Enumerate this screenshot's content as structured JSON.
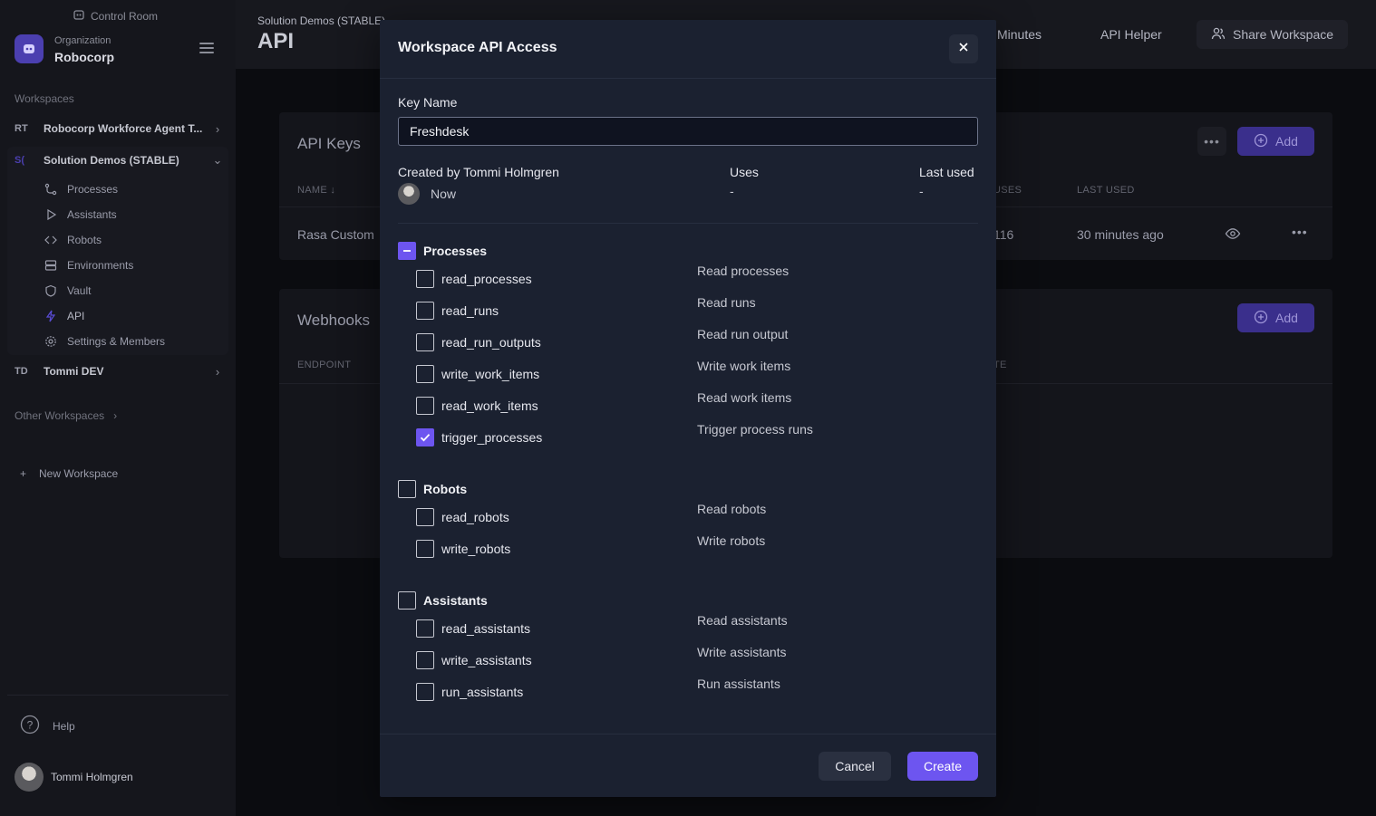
{
  "sidebar": {
    "control_room": "Control Room",
    "org_label": "Organization",
    "org_name": "Robocorp",
    "workspaces_title": "Workspaces",
    "workspaces": [
      {
        "abbr": "RT",
        "name": "Robocorp Workforce Agent T..."
      },
      {
        "abbr": "S(",
        "name": "Solution Demos (STABLE)"
      },
      {
        "abbr": "TD",
        "name": "Tommi DEV"
      }
    ],
    "nav": [
      "Processes",
      "Assistants",
      "Robots",
      "Environments",
      "Vault",
      "API",
      "Settings & Members"
    ],
    "other_workspaces": "Other Workspaces",
    "new_workspace": "New Workspace",
    "help": "Help",
    "user_name": "Tommi Holmgren"
  },
  "topbar": {
    "crumb": "Solution Demos (STABLE)",
    "title": "API",
    "minutes": "Minutes",
    "api_helper": "API Helper",
    "share": "Share Workspace"
  },
  "page": {
    "api_keys_title": "API Keys",
    "col_name": "NAME",
    "col_uses": "USES",
    "col_last_used": "LAST USED",
    "row_name": "Rasa Custom",
    "row_uses": "116",
    "row_last_used": "30 minutes ago",
    "add_label": "Add",
    "webhooks_title": "Webhooks",
    "col_endpoint": "ENDPOINT",
    "col_te": "TE"
  },
  "modal": {
    "title": "Workspace API Access",
    "key_name_label": "Key Name",
    "key_name_value": "Freshdesk",
    "created_by": "Created by Tommi Holmgren",
    "created_when": "Now",
    "uses_label": "Uses",
    "uses_value": "-",
    "last_used_label": "Last used",
    "last_used_value": "-",
    "groups": [
      {
        "label": "Processes",
        "state": "partial",
        "perms": [
          {
            "key": "read_processes",
            "desc": "Read processes",
            "checked": false
          },
          {
            "key": "read_runs",
            "desc": "Read runs",
            "checked": false
          },
          {
            "key": "read_run_outputs",
            "desc": "Read run output",
            "checked": false
          },
          {
            "key": "write_work_items",
            "desc": "Write work items",
            "checked": false
          },
          {
            "key": "read_work_items",
            "desc": "Read work items",
            "checked": false
          },
          {
            "key": "trigger_processes",
            "desc": "Trigger process runs",
            "checked": true
          }
        ]
      },
      {
        "label": "Robots",
        "state": "unchecked",
        "perms": [
          {
            "key": "read_robots",
            "desc": "Read robots",
            "checked": false
          },
          {
            "key": "write_robots",
            "desc": "Write robots",
            "checked": false
          }
        ]
      },
      {
        "label": "Assistants",
        "state": "unchecked",
        "perms": [
          {
            "key": "read_assistants",
            "desc": "Read assistants",
            "checked": false
          },
          {
            "key": "write_assistants",
            "desc": "Write assistants",
            "checked": false
          },
          {
            "key": "run_assistants",
            "desc": "Run assistants",
            "checked": false
          }
        ]
      }
    ],
    "cancel": "Cancel",
    "create": "Create"
  },
  "colors": {
    "accent": "#6d55f0",
    "modal_bg": "#1b2130",
    "sidebar_bg": "#15161c"
  }
}
